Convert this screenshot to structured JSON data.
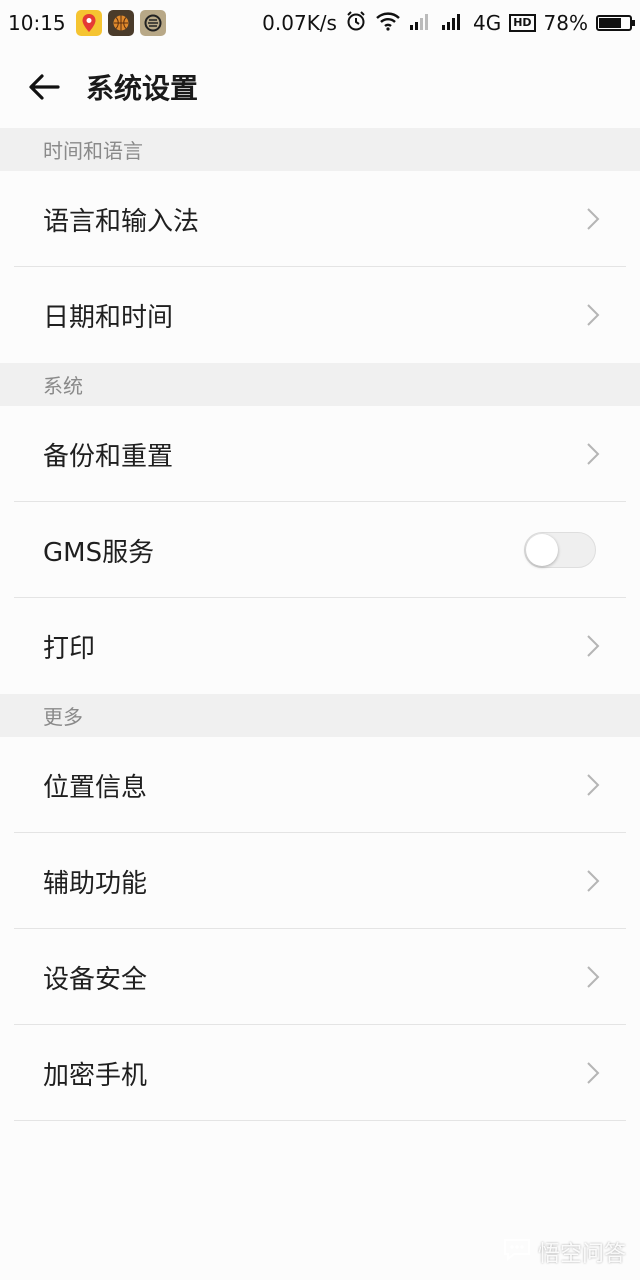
{
  "status_bar": {
    "time": "10:15",
    "net_speed": "0.07K/s",
    "network_type": "4G",
    "hd_label": "HD",
    "battery": "78%",
    "battery_level": 0.78,
    "icons": [
      "map-app-icon",
      "basketball-app-icon",
      "browser-app-icon",
      "alarm-icon",
      "wifi-icon",
      "signal-icon",
      "signal-icon",
      "battery-icon"
    ]
  },
  "header": {
    "title": "系统设置",
    "back_icon": "arrow-left-icon"
  },
  "sections": {
    "time_language": {
      "title": "时间和语言",
      "items": [
        "语言和输入法",
        "日期和时间"
      ]
    },
    "system": {
      "title": "系统",
      "items": [
        "备份和重置",
        "GMS服务",
        "打印"
      ],
      "gms_enabled": false
    },
    "more": {
      "title": "更多",
      "items": [
        "位置信息",
        "辅助功能",
        "设备安全",
        "加密手机"
      ]
    }
  },
  "watermark": {
    "text": "悟空问答"
  },
  "colors": {
    "section_bg": "#f0f0f0",
    "section_text": "#8a8a8a",
    "chevron": "#b5b5b5"
  }
}
